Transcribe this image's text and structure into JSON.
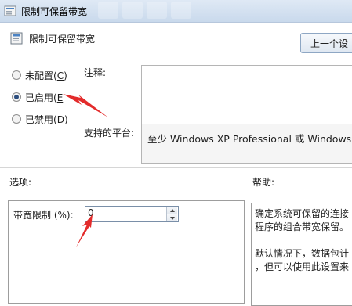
{
  "window": {
    "title": "限制可保留带宽"
  },
  "header": {
    "title": "限制可保留带宽",
    "prev_button": "上一个设"
  },
  "radios": {
    "not_configured": {
      "label": "未配置(",
      "key": "C",
      "suffix": ")"
    },
    "enabled": {
      "label": "已启用(",
      "key": "E",
      "suffix": ""
    },
    "disabled": {
      "label": "已禁用(",
      "key": "D",
      "suffix": ")"
    }
  },
  "fields": {
    "comment_label": "注释:",
    "comment_value": "",
    "platform_label": "支持的平台:",
    "platform_value": "至少 Windows XP Professional 或 Windows S"
  },
  "sections": {
    "options": "选项:",
    "help": "帮助:"
  },
  "options": {
    "bandwidth_label": "带宽限制 (%):",
    "bandwidth_value": "0"
  },
  "help": {
    "lines": [
      "确定系统可保留的连接",
      "程序的组合带宽保留。",
      "",
      "默认情况下，数据包计",
      "，但可以使用此设置来"
    ]
  },
  "annotation_color": "#e32b2b",
  "icons": [
    "policy-icon",
    "policy-icon",
    "spin-up-icon",
    "spin-down-icon"
  ]
}
